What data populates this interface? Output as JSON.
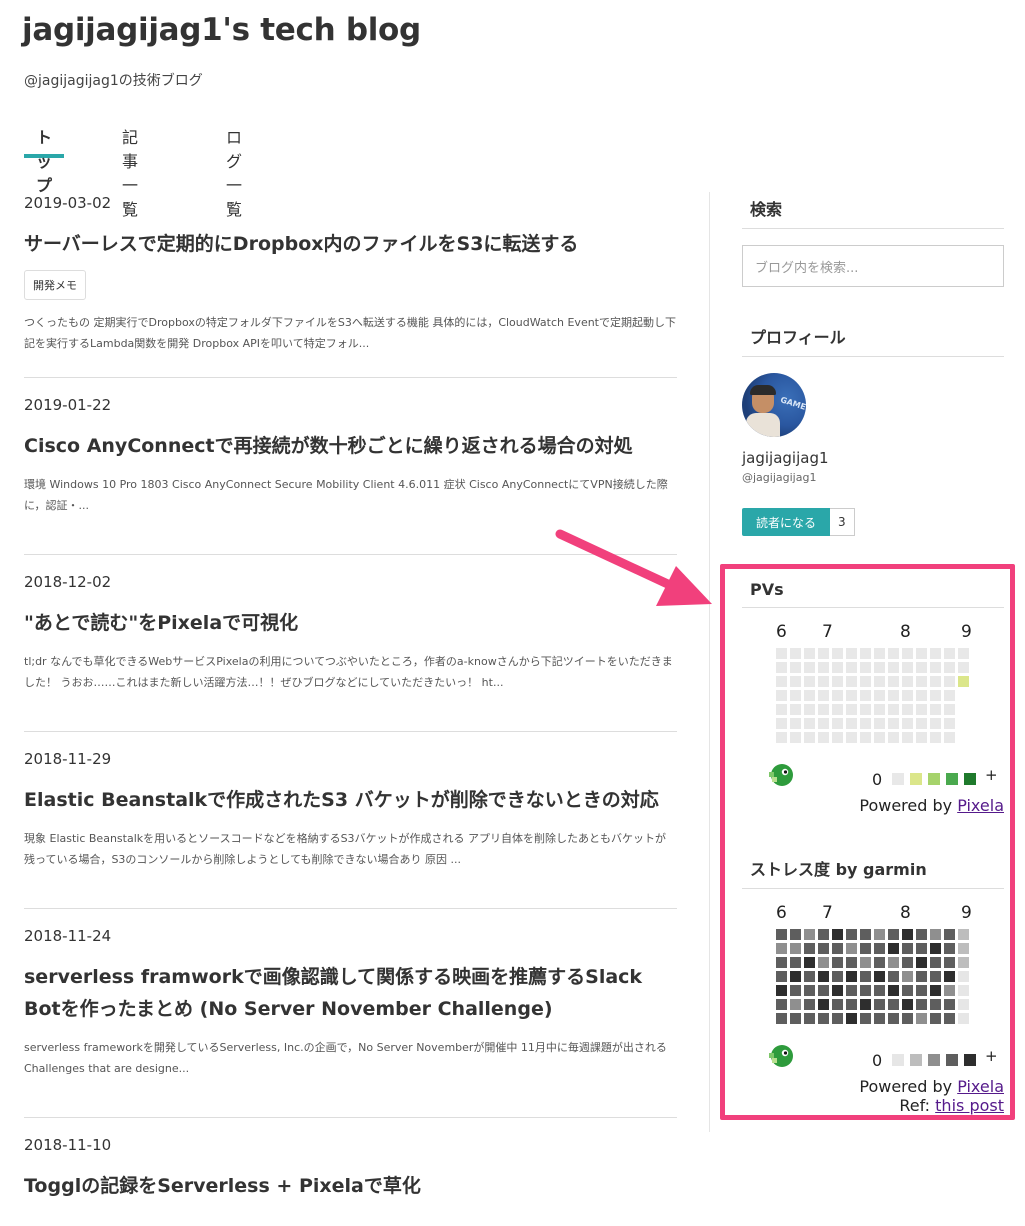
{
  "blog": {
    "title": "jagijagijag1's tech blog",
    "description": "@jagijagijag1の技術ブログ"
  },
  "nav": {
    "tabs": [
      "トップ",
      "記事一覧",
      "ログ一覧"
    ],
    "active": 0
  },
  "entries": [
    {
      "date": "2019-03-02",
      "title": "サーバーレスで定期的にDropbox内のファイルをS3に転送する",
      "tag": "開発メモ",
      "summary": "つくったもの 定期実行でDropboxの特定フォルダ下ファイルをS3へ転送する機能 具体的には，CloudWatch Eventで定期起動し下記を実行するLambda関数を開発 Dropbox APIを叩いて特定フォル..."
    },
    {
      "date": "2019-01-22",
      "title": "Cisco AnyConnectで再接続が数十秒ごとに繰り返される場合の対処",
      "tag": "",
      "summary": "環境 Windows 10 Pro 1803 Cisco AnyConnect Secure Mobility Client 4.6.011 症状 Cisco AnyConnectにてVPN接続した際に，認証・..."
    },
    {
      "date": "2018-12-02",
      "title": "\"あとで読む\"をPixelaで可視化",
      "tag": "",
      "summary": "tl;dr なんでも草化できるWebサービスPixelaの利用についてつぶやいたところ，作者のa-knowさんから下記ツイートをいただきました！ うおお……これはまた新しい活躍方法…！！ぜひブログなどにしていただきたいっ！ ht..."
    },
    {
      "date": "2018-11-29",
      "title": "Elastic Beanstalkで作成されたS3 バケットが削除できないときの対応",
      "tag": "",
      "summary": "現象 Elastic Beanstalkを用いるとソースコードなどを格納するS3バケットが作成される アプリ自体を削除したあともバケットが残っている場合，S3のコンソールから削除しようとしても削除できない場合あり 原因 ..."
    },
    {
      "date": "2018-11-24",
      "title": "serverless framworkで画像認識して関係する映画を推薦するSlack Botを作ったまとめ (No Server November Challenge)",
      "tag": "",
      "summary": "serverless frameworkを開発しているServerless, Inc.の企画で，No Server Novemberが開催中 11月中に毎週課題が出される Challenges that are designe..."
    },
    {
      "date": "2018-11-10",
      "title": "Togglの記録をServerless + Pixelaで草化",
      "tag": "",
      "summary": ""
    }
  ],
  "sidebar": {
    "search": {
      "heading": "検索",
      "placeholder": "ブログ内を検索..."
    },
    "profile": {
      "heading": "プロフィール",
      "name": "jagijagijag1",
      "id": "@jagijagijag1",
      "subscribe_label": "読者になる",
      "subscriber_count": "3",
      "avatar_text": "GAME"
    },
    "pv": {
      "heading": "PVs",
      "months": [
        "6",
        "7",
        "8",
        "9"
      ],
      "legend_min": "0",
      "legend_max": "+",
      "powered_prefix": "Powered by ",
      "powered_link": "Pixela",
      "palette": [
        "#e8e8e8",
        "#dbe68a",
        "#a6d36b",
        "#4aa94e",
        "#1f7a2c"
      ],
      "weeks": [
        [
          0,
          0,
          0,
          0,
          0,
          0,
          0
        ],
        [
          0,
          0,
          0,
          0,
          0,
          0,
          0
        ],
        [
          0,
          0,
          0,
          0,
          0,
          0,
          0
        ],
        [
          0,
          0,
          0,
          0,
          0,
          0,
          0
        ],
        [
          0,
          0,
          0,
          0,
          0,
          0,
          0
        ],
        [
          0,
          0,
          0,
          0,
          0,
          0,
          0
        ],
        [
          0,
          0,
          0,
          0,
          0,
          0,
          0
        ],
        [
          0,
          0,
          0,
          0,
          0,
          0,
          0
        ],
        [
          0,
          0,
          0,
          0,
          0,
          0,
          0
        ],
        [
          0,
          0,
          0,
          0,
          0,
          0,
          0
        ],
        [
          0,
          0,
          0,
          0,
          0,
          0,
          0
        ],
        [
          0,
          0,
          0,
          0,
          0,
          0,
          0
        ],
        [
          0,
          0,
          0,
          0,
          0,
          0,
          0
        ],
        [
          0,
          0,
          1
        ]
      ]
    },
    "stress": {
      "heading": "ストレス度 by garmin",
      "months": [
        "6",
        "7",
        "8",
        "9"
      ],
      "legend_min": "0",
      "legend_max": "+",
      "powered_prefix": "Powered by ",
      "powered_link": "Pixela",
      "ref_prefix": "Ref: ",
      "ref_link": "this post",
      "palette": [
        "#e6e6e6",
        "#bdbdbd",
        "#8f8f8f",
        "#5e5e5e",
        "#2e2e2e"
      ],
      "weeks": [
        [
          3,
          2,
          3,
          3,
          4,
          3,
          3
        ],
        [
          3,
          2,
          3,
          4,
          3,
          2,
          3
        ],
        [
          2,
          3,
          4,
          3,
          3,
          3,
          3
        ],
        [
          3,
          3,
          2,
          4,
          3,
          4,
          3
        ],
        [
          4,
          3,
          3,
          3,
          4,
          3,
          3
        ],
        [
          3,
          2,
          3,
          4,
          3,
          3,
          4
        ],
        [
          3,
          3,
          2,
          3,
          3,
          4,
          3
        ],
        [
          2,
          3,
          3,
          4,
          3,
          3,
          3
        ],
        [
          3,
          4,
          2,
          3,
          4,
          3,
          3
        ],
        [
          4,
          3,
          3,
          2,
          3,
          4,
          3
        ],
        [
          3,
          3,
          4,
          3,
          3,
          3,
          2
        ],
        [
          2,
          4,
          3,
          3,
          4,
          3,
          3
        ],
        [
          3,
          3,
          3,
          4,
          2,
          3,
          3
        ],
        [
          1,
          1,
          1,
          0,
          0,
          0,
          0
        ]
      ]
    }
  }
}
